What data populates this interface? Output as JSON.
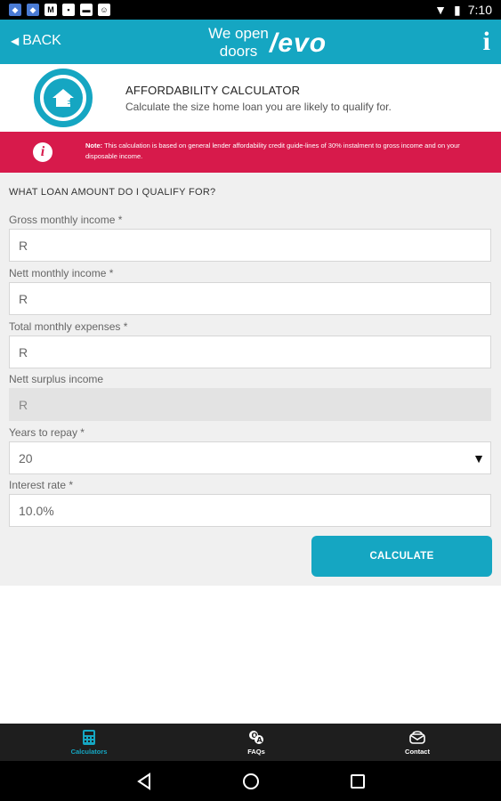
{
  "status_bar": {
    "time": "7:10",
    "notification_icons": [
      "dropbox-icon",
      "dropbox-icon",
      "gmail-icon",
      "photo-icon",
      "chat-icon",
      "android-icon"
    ]
  },
  "header": {
    "back_label": "BACK",
    "logo_tagline": "We open doors",
    "logo_mark": "/evo",
    "info_label": "i"
  },
  "intro": {
    "title": "AFFORDABILITY CALCULATOR",
    "subtitle": "Calculate the size home loan you are likely to qualify for."
  },
  "notice": {
    "note_label": "Note:",
    "text": "This calculation is based on general lender affordability credit guide-lines of 30% instalment to gross income and on your disposable income."
  },
  "form": {
    "heading": "WHAT LOAN AMOUNT DO I QUALIFY FOR?",
    "gross_label": "Gross monthly income *",
    "gross_value": "R",
    "nett_label": "Nett monthly income *",
    "nett_value": "R",
    "expenses_label": "Total monthly expenses *",
    "expenses_value": "R",
    "surplus_label": "Nett surplus income",
    "surplus_value": "R",
    "years_label": "Years to repay *",
    "years_value": "20",
    "interest_label": "Interest rate *",
    "interest_value": "10.0%",
    "calculate_label": "CALCULATE"
  },
  "bottom_nav": [
    {
      "label": "Calculators",
      "icon": "calculator-icon",
      "active": true
    },
    {
      "label": "FAQs",
      "icon": "faq-icon",
      "active": false
    },
    {
      "label": "Contact",
      "icon": "contact-icon",
      "active": false
    }
  ],
  "colors": {
    "brand": "#15a6c2",
    "alert": "#d71a4b"
  }
}
